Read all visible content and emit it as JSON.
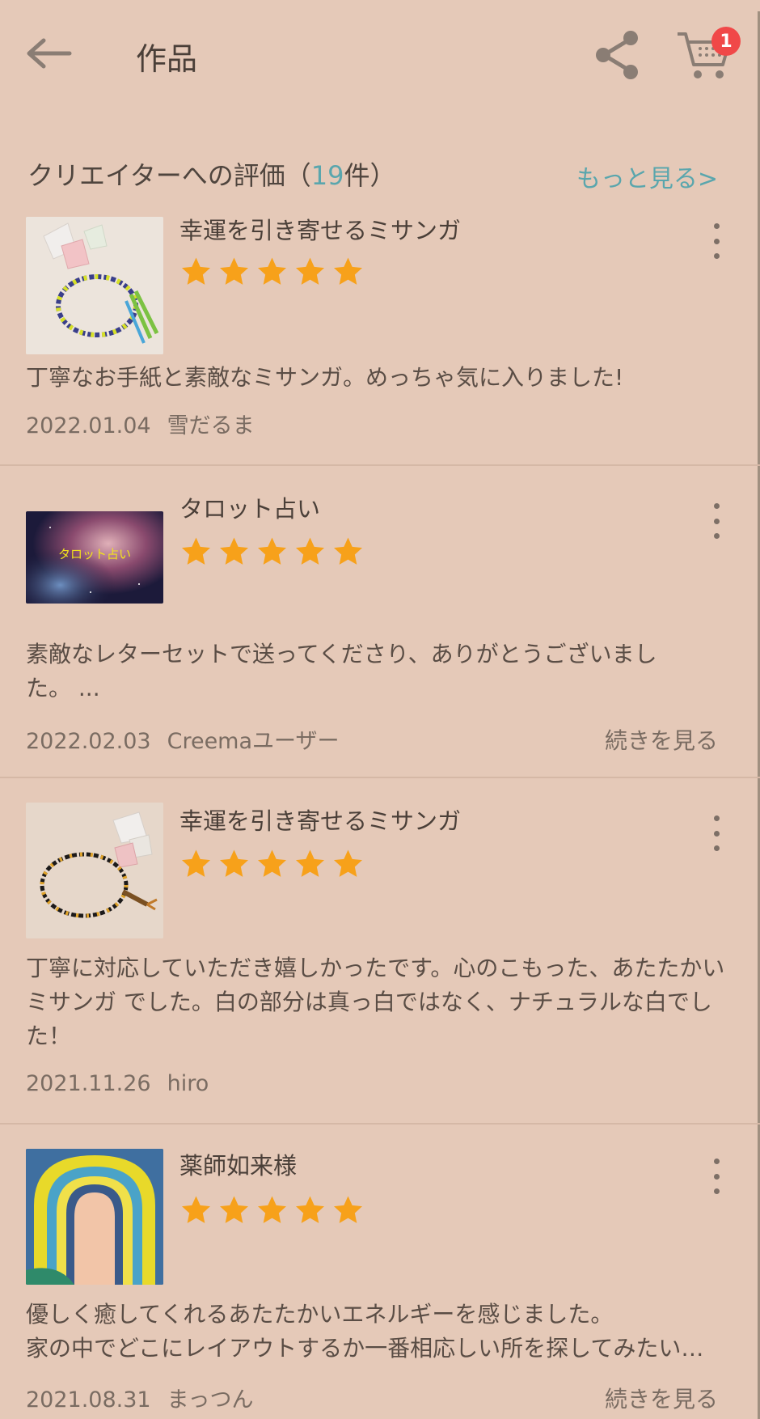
{
  "header": {
    "title": "作品",
    "cart_count": "1"
  },
  "section": {
    "title_prefix": "クリエイターへの評価（",
    "count": "19",
    "title_suffix": "件）",
    "more_link": "もっと見る>"
  },
  "colors": {
    "background": "#e5c9b8",
    "accent": "#5aa6ad",
    "star": "#f7a11a",
    "badge": "#f04848"
  },
  "reviews": [
    {
      "product": "幸運を引き寄せるミサンガ",
      "rating": 5,
      "text": "丁寧なお手紙と素敵なミサンガ。めっちゃ気に入りました!",
      "date": "2022.01.04",
      "author": "雪だるま",
      "read_more": ""
    },
    {
      "product": "タロット占い",
      "rating": 5,
      "thumb_caption": "タロット占い",
      "text": "素敵なレターセットで送ってくださり、ありがとうございました。 ...",
      "date": "2022.02.03",
      "author": "Creemaユーザー",
      "read_more": "続きを見る"
    },
    {
      "product": "幸運を引き寄せるミサンガ",
      "rating": 5,
      "text": "丁寧に対応していただき嬉しかったです。心のこもった、あたたかいミサンガ でした。白の部分は真っ白ではなく、ナチュラルな白でした！",
      "date": "2021.11.26",
      "author": "hiro",
      "read_more": ""
    },
    {
      "product": "薬師如来様",
      "rating": 5,
      "text_line1": "優しく癒してくれるあたたかいエネルギーを感じました。",
      "text_line2": "家の中でどこにレイアウトするか一番相応しい所を探してみたい…",
      "date": "2021.08.31",
      "author": "まっつん",
      "read_more": "続きを見る"
    }
  ]
}
